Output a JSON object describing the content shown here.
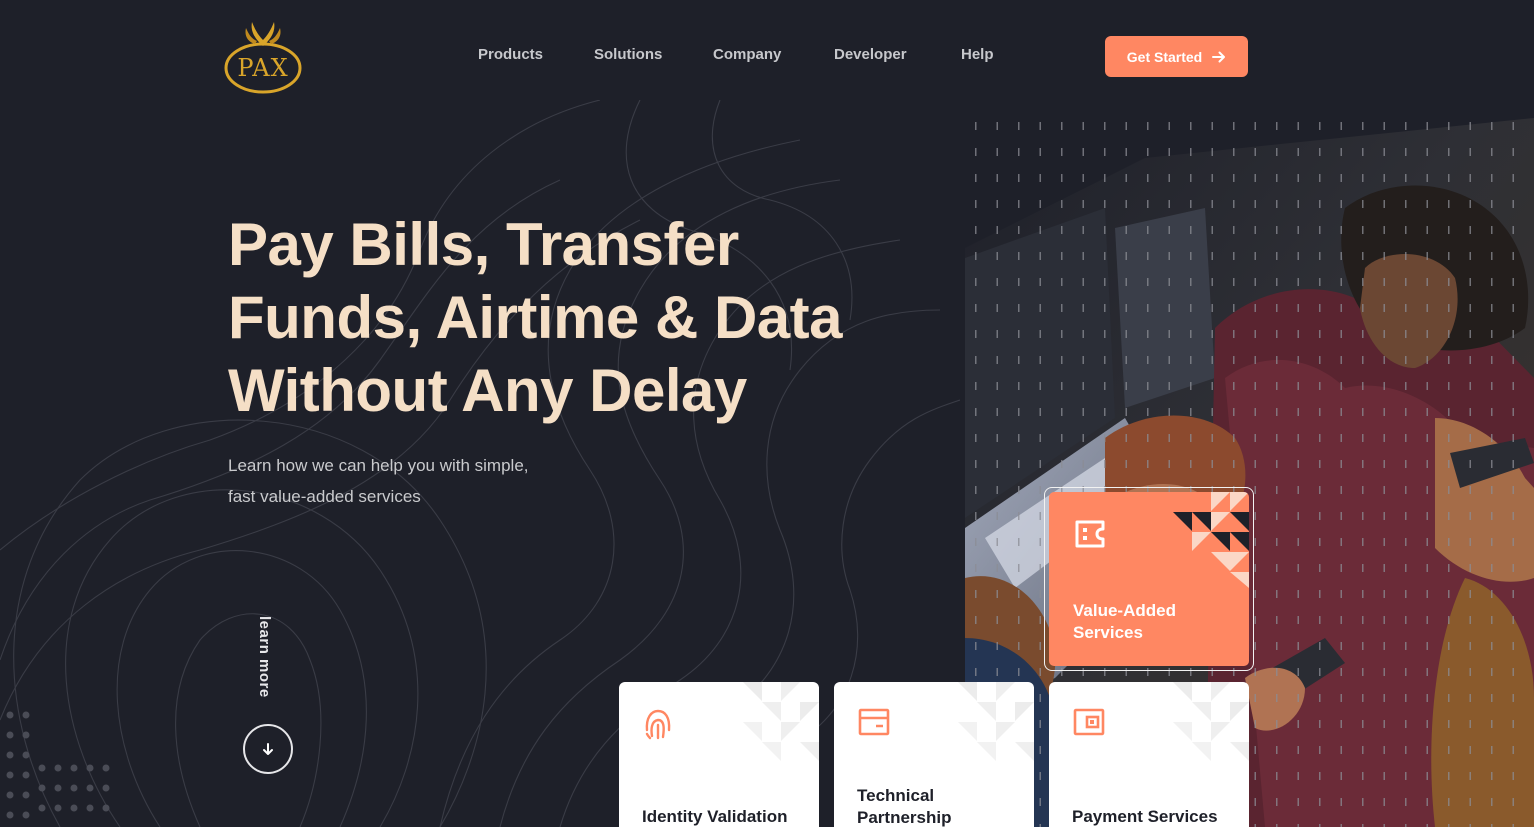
{
  "brand": {
    "logo_text": "PAX",
    "logo_color": "#d9a52a"
  },
  "nav": {
    "items": [
      {
        "label": "Products"
      },
      {
        "label": "Solutions"
      },
      {
        "label": "Company"
      },
      {
        "label": "Developer"
      },
      {
        "label": "Help"
      }
    ],
    "cta_label": "Get Started",
    "cta_icon": "arrow-right-icon"
  },
  "hero": {
    "title_line1": "Pay Bills, Transfer",
    "title_line2": "Funds, Airtime & Data",
    "title_line3": "Without Any Delay",
    "subtitle_line1": "Learn how we can help you with simple,",
    "subtitle_line2": "fast value-added services",
    "learn_more": "learn more"
  },
  "services": {
    "featured": {
      "label": "Value-Added Services",
      "icon": "ticket-icon"
    },
    "cards": [
      {
        "label": "Identity Validation",
        "icon": "fingerprint-icon"
      },
      {
        "label": "Technical Partnership",
        "icon": "card-icon"
      },
      {
        "label": "Payment Services",
        "icon": "wallet-icon"
      }
    ]
  },
  "colors": {
    "background": "#1e2029",
    "accent": "#ff8762",
    "headline": "#f5dfc6"
  }
}
